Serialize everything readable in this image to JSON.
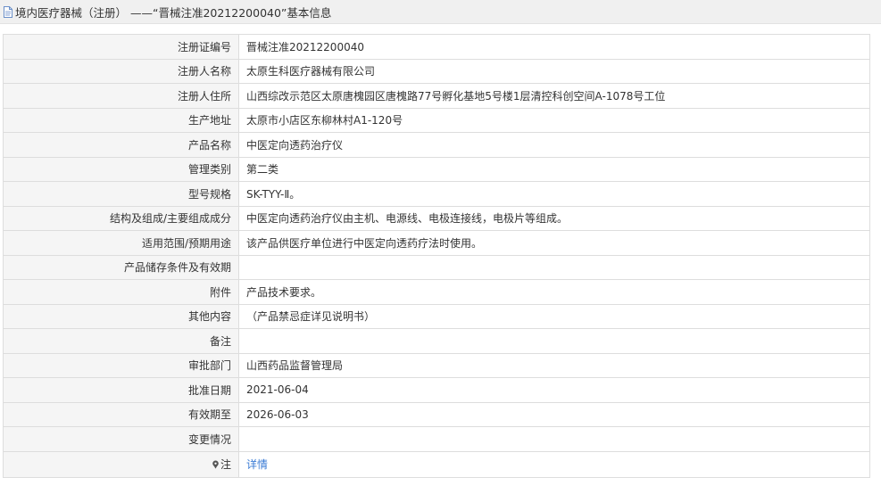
{
  "page": {
    "title": "境内医疗器械（注册） ——“晋械注准20212200040”基本信息"
  },
  "rows": [
    {
      "label": "注册证编号",
      "value": "晋械注准20212200040"
    },
    {
      "label": "注册人名称",
      "value": "太原生科医疗器械有限公司"
    },
    {
      "label": "注册人住所",
      "value": "山西综改示范区太原唐槐园区唐槐路77号孵化基地5号楼1层清控科创空间A-1078号工位"
    },
    {
      "label": "生产地址",
      "value": "太原市小店区东柳林村A1-120号"
    },
    {
      "label": "产品名称",
      "value": "中医定向透药治疗仪"
    },
    {
      "label": "管理类别",
      "value": "第二类"
    },
    {
      "label": "型号规格",
      "value": "SK-TYY-Ⅱ。"
    },
    {
      "label": "结构及组成/主要组成成分",
      "value": "中医定向透药治疗仪由主机、电源线、电极连接线，电极片等组成。"
    },
    {
      "label": "适用范围/预期用途",
      "value": "该产品供医疗单位进行中医定向透药疗法时使用。"
    },
    {
      "label": "产品储存条件及有效期",
      "value": ""
    },
    {
      "label": "附件",
      "value": "产品技术要求。"
    },
    {
      "label": "其他内容",
      "value": "（产品禁忌症详见说明书）"
    },
    {
      "label": "备注",
      "value": ""
    },
    {
      "label": "审批部门",
      "value": "山西药品监督管理局"
    },
    {
      "label": "批准日期",
      "value": "2021-06-04"
    },
    {
      "label": "有效期至",
      "value": "2026-06-03"
    },
    {
      "label": "变更情况",
      "value": ""
    }
  ],
  "note_row": {
    "label": "注",
    "link_text": "详情",
    "icon": "pin-icon"
  },
  "icons": {
    "title": "document-icon"
  },
  "colors": {
    "title_bar_bg": "#f0f0f0",
    "label_bg": "#f5f5f5",
    "border": "#dddddd",
    "link": "#3a7bd5"
  }
}
